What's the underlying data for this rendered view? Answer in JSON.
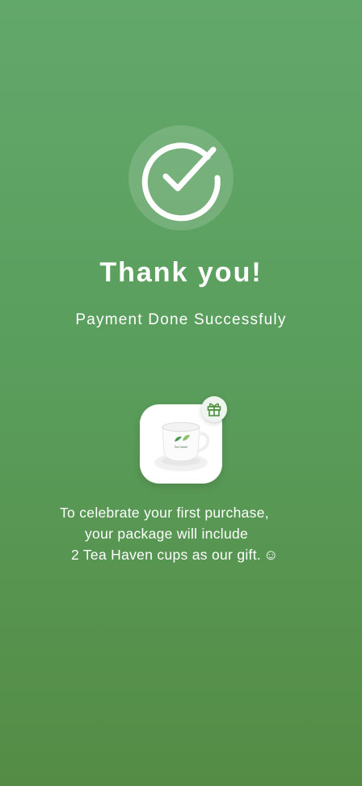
{
  "header": {
    "title": "Thank you!",
    "subtitle": "Payment Done Successfuly"
  },
  "gift": {
    "cup_brand": "Tea Haven",
    "icon": "gift-icon",
    "product_icon": "teacup-icon"
  },
  "message": {
    "line1": "To celebrate your first purchase,",
    "line2": "your package will include",
    "line3": "2 Tea Haven cups as our gift.",
    "emoji": "☺"
  },
  "colors": {
    "background_top": "#63a86b",
    "background_bottom": "#548c45",
    "accent": "#4f8f3f",
    "text": "#ffffff"
  }
}
